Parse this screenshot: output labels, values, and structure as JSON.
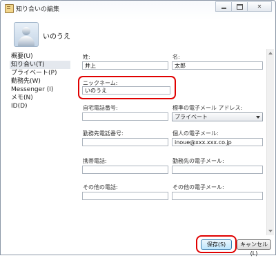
{
  "window": {
    "title": "知り合いの編集",
    "close_symbol": "✕"
  },
  "contact": {
    "display_name": "いのうえ"
  },
  "sidebar": {
    "items": [
      {
        "label": "概要(U)",
        "selected": false
      },
      {
        "label": "知り合い(T)",
        "selected": true
      },
      {
        "label": "プライベート(P)",
        "selected": false
      },
      {
        "label": "勤務先(W)",
        "selected": false
      },
      {
        "label": "Messenger (I)",
        "selected": false
      },
      {
        "label": "メモ(N)",
        "selected": false
      },
      {
        "label": "ID(D)",
        "selected": false
      }
    ]
  },
  "form": {
    "last_name": {
      "label": "姓:",
      "value": "井上"
    },
    "first_name": {
      "label": "名:",
      "value": "太郎"
    },
    "nickname": {
      "label": "ニックネーム:",
      "value": "いのうえ"
    },
    "home_phone": {
      "label": "自宅電話番号:",
      "value": ""
    },
    "default_email": {
      "label": "標準の電子メール アドレス:",
      "selected": "プライベート"
    },
    "work_phone": {
      "label": "勤務先電話番号:",
      "value": ""
    },
    "personal_email": {
      "label": "個人の電子メール:",
      "value": "inoue@xxx.xxx.co.jp"
    },
    "mobile_phone": {
      "label": "携帯電話:",
      "value": ""
    },
    "work_email": {
      "label": "勤務先の電子メール:",
      "value": ""
    },
    "other_phone": {
      "label": "その他の電話:",
      "value": ""
    },
    "other_email": {
      "label": "その他の電子メール:",
      "value": ""
    }
  },
  "buttons": {
    "save": "保存(S)",
    "cancel": "キャンセル(L)"
  },
  "colors": {
    "highlight": "#e00000",
    "selected_bg": "#e4e8ee",
    "primary_button": "#bee6fd"
  }
}
